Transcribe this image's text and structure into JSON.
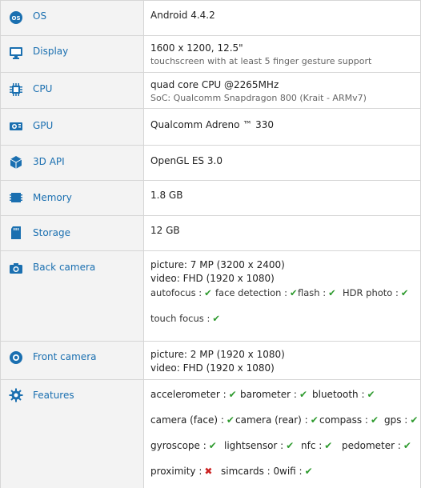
{
  "rows": {
    "os": {
      "label": "OS",
      "value": "Android 4.4.2"
    },
    "display": {
      "label": "Display",
      "value": "1600 x 1200, 12.5\"",
      "sub": "touchscreen with at least 5 finger gesture support"
    },
    "cpu": {
      "label": "CPU",
      "value": "quad core CPU @2265MHz",
      "sub": "SoC: Qualcomm Snapdragon 800 (Krait - ARMv7)"
    },
    "gpu": {
      "label": "GPU",
      "value": "Qualcomm Adreno ™ 330"
    },
    "api": {
      "label": "3D API",
      "value": "OpenGL ES 3.0"
    },
    "memory": {
      "label": "Memory",
      "value": "1.8 GB"
    },
    "storage": {
      "label": "Storage",
      "value": "12 GB"
    },
    "back_camera": {
      "label": "Back camera",
      "picture": "picture: 7 MP (3200 x 2400)",
      "video": "video: FHD (1920 x 1080)",
      "autofocus": "autofocus :",
      "face_detection": "face detection :",
      "flash": "flash :",
      "hdr": "HDR photo :",
      "touch_focus": "touch focus :"
    },
    "front_camera": {
      "label": "Front camera",
      "picture": "picture: 2 MP (1920 x 1080)",
      "video": "video: FHD (1920 x 1080)"
    },
    "features": {
      "label": "Features",
      "accelerometer": "accelerometer :",
      "barometer": "barometer :",
      "bluetooth": "bluetooth :",
      "camera_face": "camera (face) :",
      "camera_rear": "camera (rear) :",
      "compass": "compass :",
      "gps": "gps :",
      "gyroscope": "gyroscope :",
      "lightsensor": "lightsensor :",
      "nfc": "nfc :",
      "pedometer": "pedometer :",
      "proximity": "proximity :",
      "simcards": "simcards : 0",
      "wifi": "wifi :"
    }
  },
  "marks": {
    "yes": "✔",
    "no": "✖"
  },
  "colors": {
    "label": "#1a6fb0",
    "yes": "#2e9a2e",
    "no": "#cc2222",
    "label_bg": "#f3f3f3"
  }
}
